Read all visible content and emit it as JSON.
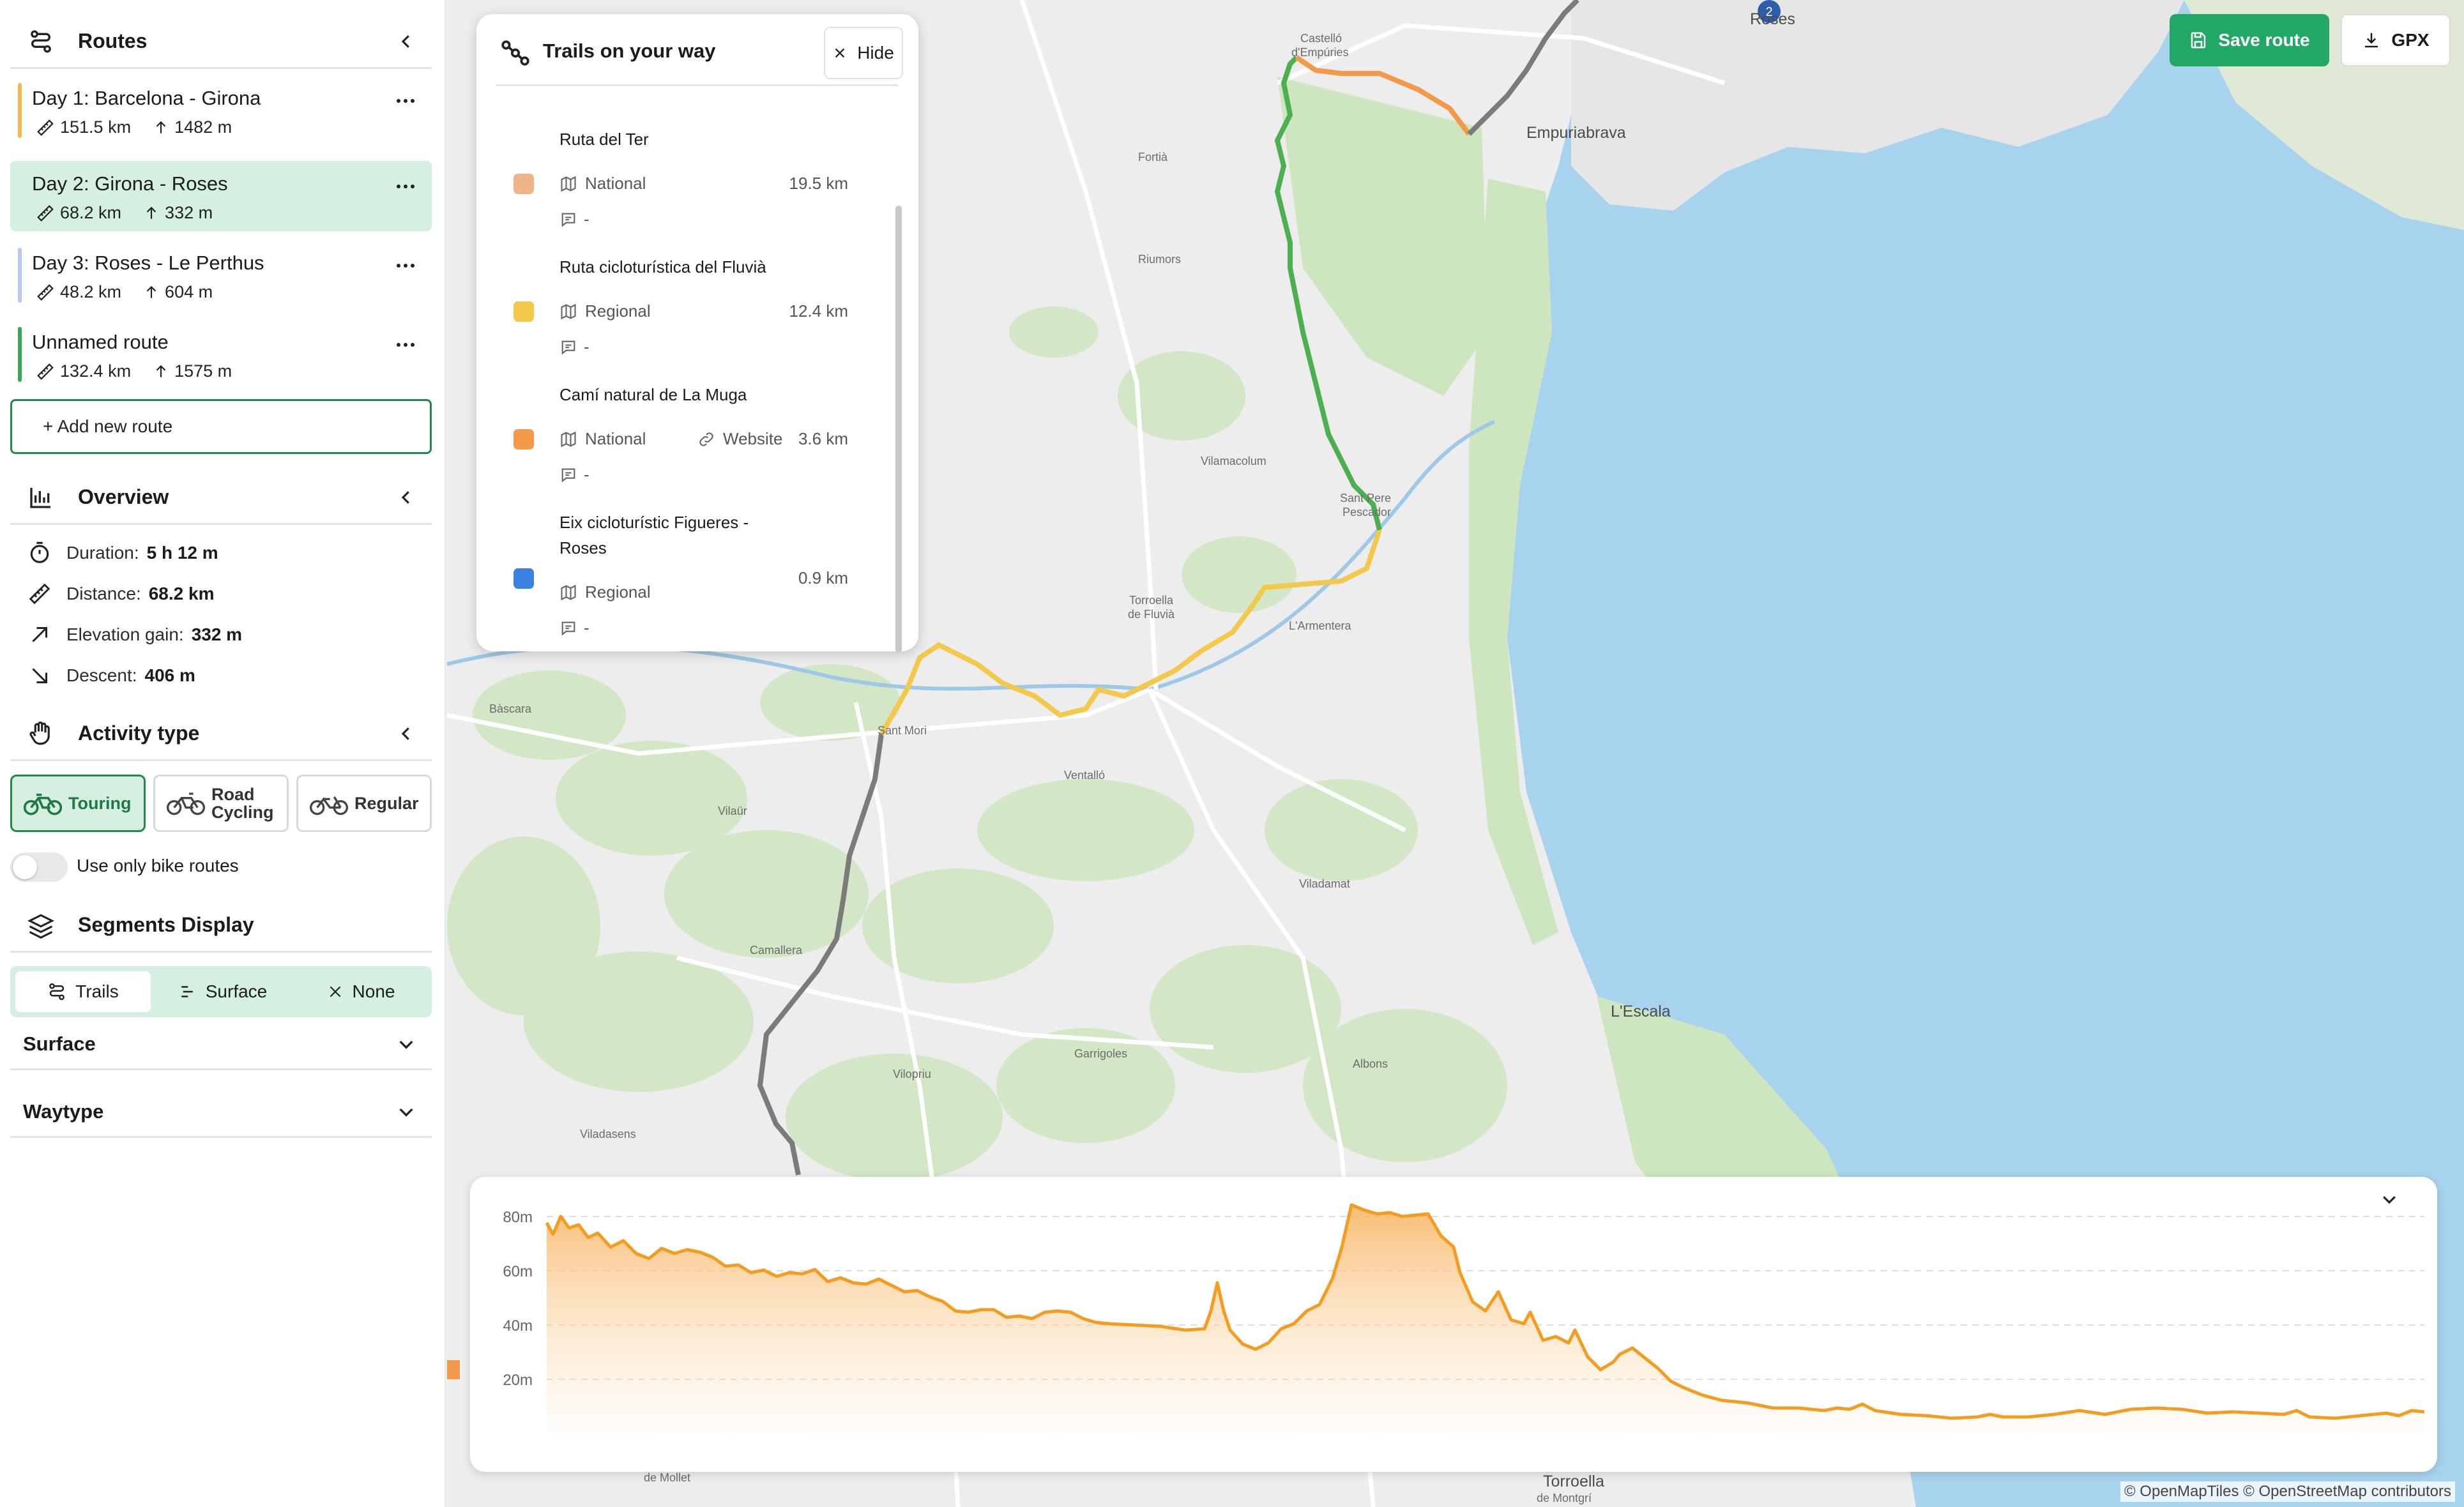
{
  "sidebar": {
    "routes": {
      "title": "Routes",
      "items": [
        {
          "name": "Day 1: Barcelona - Girona",
          "distance": "151.5 km",
          "elevation": "1482 m",
          "color": "#f2b84b",
          "active": false
        },
        {
          "name": "Day 2: Girona - Roses",
          "distance": "68.2 km",
          "elevation": "332 m",
          "color": "#d5efe0",
          "active": true
        },
        {
          "name": "Day 3: Roses - Le Perthus",
          "distance": "48.2 km",
          "elevation": "604 m",
          "color": "#b9c8f0",
          "active": false
        },
        {
          "name": "Unnamed route",
          "distance": "132.4 km",
          "elevation": "1575 m",
          "color": "#34a853",
          "active": false
        }
      ],
      "add_label": "+ Add new route"
    },
    "overview": {
      "title": "Overview",
      "rows": [
        {
          "label": "Duration:",
          "value": "5 h 12 m"
        },
        {
          "label": "Distance:",
          "value": "68.2 km"
        },
        {
          "label": "Elevation gain:",
          "value": "332 m"
        },
        {
          "label": "Descent:",
          "value": "406 m"
        }
      ]
    },
    "activity": {
      "title": "Activity type",
      "options": [
        {
          "label": "Touring",
          "active": true
        },
        {
          "label_line1": "Road",
          "label_line2": "Cycling",
          "active": false
        },
        {
          "label": "Regular",
          "active": false
        }
      ],
      "bike_only_label": "Use only bike routes",
      "bike_only_on": false
    },
    "segments": {
      "title": "Segments Display",
      "options": [
        {
          "label": "Trails",
          "active": true
        },
        {
          "label": "Surface",
          "active": false
        },
        {
          "label": "None",
          "active": false
        }
      ]
    },
    "surface": {
      "title": "Surface"
    },
    "waytype": {
      "title": "Waytype"
    }
  },
  "trails_panel": {
    "title": "Trails on your way",
    "hide_label": "Hide",
    "trails": [
      {
        "name": "Ruta del Ter",
        "type": "National",
        "distance": "19.5 km",
        "comment": "-",
        "color": "#f0b487",
        "website": ""
      },
      {
        "name": "Ruta cicloturística del Fluvià",
        "type": "Regional",
        "distance": "12.4 km",
        "comment": "-",
        "color": "#f2c94c",
        "website": ""
      },
      {
        "name": "Camí natural de La Muga",
        "type": "National",
        "distance": "3.6 km",
        "comment": "-",
        "color": "#f2994a",
        "website": "Website"
      },
      {
        "name_line1": "Eix cicloturístic Figueres -",
        "name_line2": "Roses",
        "type": "Regional",
        "distance": "0.9 km",
        "comment": "-",
        "color": "#3b82e0",
        "website": ""
      }
    ]
  },
  "toolbar": {
    "save_label": "Save route",
    "gpx_label": "GPX"
  },
  "map": {
    "labels": {
      "castello": "Castelló",
      "castello2": "d'Empúries",
      "roses": "Roses",
      "empuriabrava": "Empuriabrava",
      "fortia": "Fortià",
      "riumors": "Riumors",
      "vilamacolum": "Vilamacolum",
      "santpere1": "Sant Pere",
      "santpere2": "Pescador",
      "torroella1": "Torroella",
      "torroella2": "de Fluvià",
      "armentera": "L'Armentera",
      "bascara": "Bàscara",
      "santmori": "Sant Mori",
      "ventallo": "Ventalló",
      "vilaur": "Vilaür",
      "viladamat": "Viladamat",
      "camallera": "Camallera",
      "lescala": "L'Escala",
      "garrigoles": "Garrigoles",
      "vilopriu": "Vilopriu",
      "albons": "Albons",
      "viladasens": "Viladasens",
      "demollet": "de Mollet",
      "torroella_mont1": "Torroella",
      "torroella_mont2": "de Montgrí",
      "road_badge": "2"
    },
    "attribution": "© OpenMapTiles © OpenStreetMap contributors"
  },
  "elevation": {
    "y_ticks": [
      "80m",
      "60m",
      "40m",
      "20m"
    ],
    "line_color": "#f39c1f"
  },
  "colors": {
    "accent": "#22a866",
    "accent_light": "#d5efe0",
    "route_green": "#4caf50",
    "route_yellow": "#f2c94c",
    "route_orange": "#f2994a",
    "route_gray": "#808080",
    "sea": "#a8d3ee",
    "forest": "#cde6c0"
  }
}
